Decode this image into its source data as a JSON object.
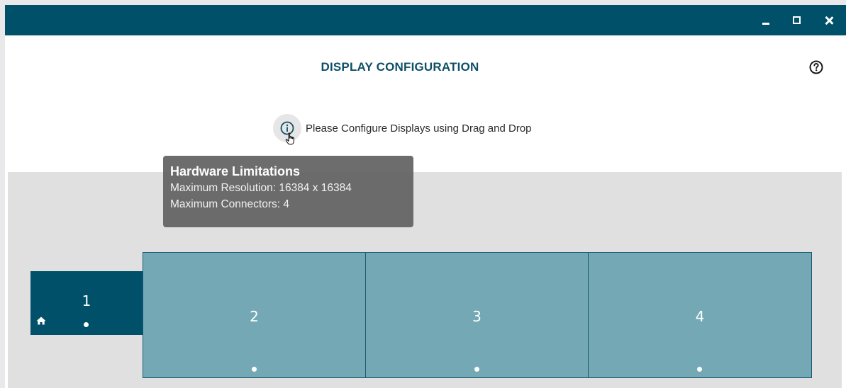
{
  "window": {
    "controls": {
      "minimize_icon": "minimize-icon",
      "maximize_icon": "maximize-icon",
      "close_icon": "close-icon"
    },
    "titlebar_color": "#005069"
  },
  "header": {
    "title": "DISPLAY CONFIGURATION",
    "help_icon": "help-circle-icon"
  },
  "info": {
    "icon": "info-circle-icon",
    "text": "Please Configure Displays using Drag and Drop"
  },
  "tooltip": {
    "title": "Hardware Limitations",
    "max_resolution": "Maximum Resolution: 16384 x 16384",
    "max_connectors": "Maximum Connectors: 4"
  },
  "displays": [
    {
      "label": "1",
      "primary": true,
      "color": "#005069"
    },
    {
      "label": "2",
      "primary": false,
      "color": "#74a8b5"
    },
    {
      "label": "3",
      "primary": false,
      "color": "#74a8b5"
    },
    {
      "label": "4",
      "primary": false,
      "color": "#74a8b5"
    }
  ],
  "colors": {
    "accent": "#005069",
    "title_text": "#0e4f68",
    "canvas": "#e0e0e0",
    "secondary_display": "#74a8b5"
  }
}
